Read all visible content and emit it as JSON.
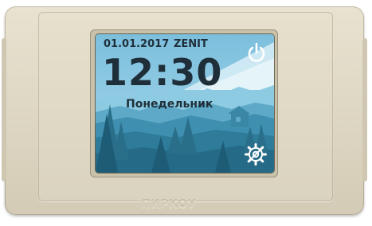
{
  "thermostat": {
    "date": "01.01.2017",
    "brand": "ZENIT",
    "time": "12:30",
    "weekday": "Понедельник",
    "logo": "ПИРКОУ",
    "icons": {
      "power": "power-icon",
      "settings": "settings-gear-wrench-icon"
    },
    "colors": {
      "text": "#1f2f3a",
      "icon": "#ffffff",
      "sky": "#7fc0dd",
      "forest": "#2a6f8a",
      "case": "#ddd6c2"
    }
  }
}
